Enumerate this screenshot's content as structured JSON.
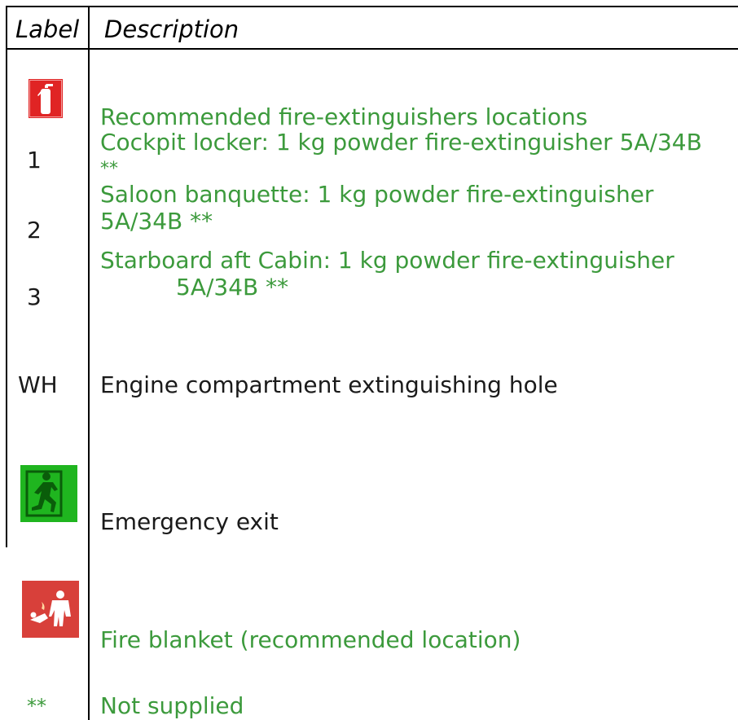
{
  "header": {
    "label": "Label",
    "description": "Description"
  },
  "rows": {
    "fire_extinguisher": {
      "icon": "fire-extinguisher-icon",
      "title": "Recommended fire-extinguishers locations",
      "items": [
        {
          "label": "1",
          "line1": "Cockpit locker: 1 kg powder fire-extinguisher 5A/34B",
          "line2": "**"
        },
        {
          "label": "2",
          "line1": "Saloon banquette: 1 kg powder fire-extinguisher",
          "line2": "5A/34B **"
        },
        {
          "label": "3",
          "line1": "Starboard aft Cabin: 1 kg powder fire-extinguisher",
          "line2": "5A/34B **"
        }
      ]
    },
    "wh": {
      "label": "WH",
      "description": "Engine compartment extinguishing hole"
    },
    "emergency_exit": {
      "icon": "emergency-exit-icon",
      "description": "Emergency exit"
    },
    "fire_blanket": {
      "icon": "fire-blanket-icon",
      "description": "Fire blanket (recommended location)"
    },
    "not_supplied": {
      "label": "**",
      "description": "Not supplied"
    }
  },
  "colors": {
    "green_text": "#3c9a3c",
    "extinguisher_red": "#e02424",
    "exit_green": "#1fb51f",
    "blanket_red": "#d8403a"
  }
}
